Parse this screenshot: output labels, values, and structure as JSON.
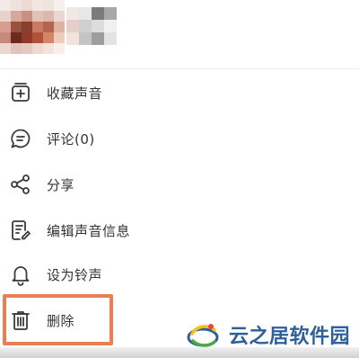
{
  "header": {
    "avatar_icon": "pixelated-profile-image",
    "name_icon": "pixelated-profile-name"
  },
  "menu": {
    "items": [
      {
        "label": "收藏声音",
        "icon": "add-to-favorites-icon"
      },
      {
        "label": "评论(0)",
        "icon": "comment-icon"
      },
      {
        "label": "分享",
        "icon": "share-icon"
      },
      {
        "label": "编辑声音信息",
        "icon": "edit-info-icon"
      },
      {
        "label": "设为铃声",
        "icon": "bell-icon"
      },
      {
        "label": "删除",
        "icon": "trash-icon"
      }
    ]
  },
  "watermark": {
    "text": "云之居软件园"
  },
  "colors": {
    "highlight": "#e87f55",
    "text": "#333333",
    "icon": "#3a3a3a",
    "watermark": "#2d5f98"
  }
}
